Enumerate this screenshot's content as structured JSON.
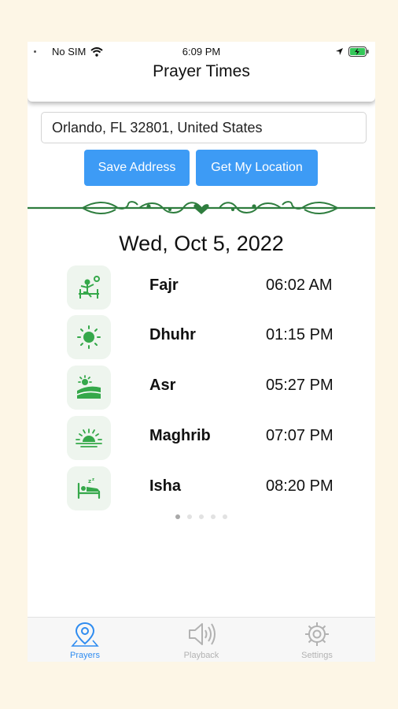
{
  "status_bar": {
    "carrier": "No SIM",
    "time": "6:09 PM"
  },
  "header": {
    "title": "Prayer Times"
  },
  "address": {
    "value": "Orlando, FL 32801, United States"
  },
  "buttons": {
    "save": "Save Address",
    "location": "Get My Location"
  },
  "date": "Wed, Oct 5, 2022",
  "prayers": [
    {
      "name": "Fajr",
      "time": "06:02 AM",
      "icon": "sunrise-stretch-icon"
    },
    {
      "name": "Dhuhr",
      "time": "01:15 PM",
      "icon": "sun-icon"
    },
    {
      "name": "Asr",
      "time": "05:27 PM",
      "icon": "afternoon-landscape-icon"
    },
    {
      "name": "Maghrib",
      "time": "07:07 PM",
      "icon": "sunset-icon"
    },
    {
      "name": "Isha",
      "time": "08:20 PM",
      "icon": "sleep-bed-icon"
    }
  ],
  "pager": {
    "pages": 5,
    "active": 0
  },
  "tabs": [
    {
      "label": "Prayers",
      "icon": "map-pin-icon",
      "active": true
    },
    {
      "label": "Playback",
      "icon": "speaker-icon",
      "active": false
    },
    {
      "label": "Settings",
      "icon": "gear-icon",
      "active": false
    }
  ],
  "colors": {
    "accent": "#3d9bf5",
    "green": "#2e7d3e",
    "background": "#fdf6e6"
  }
}
